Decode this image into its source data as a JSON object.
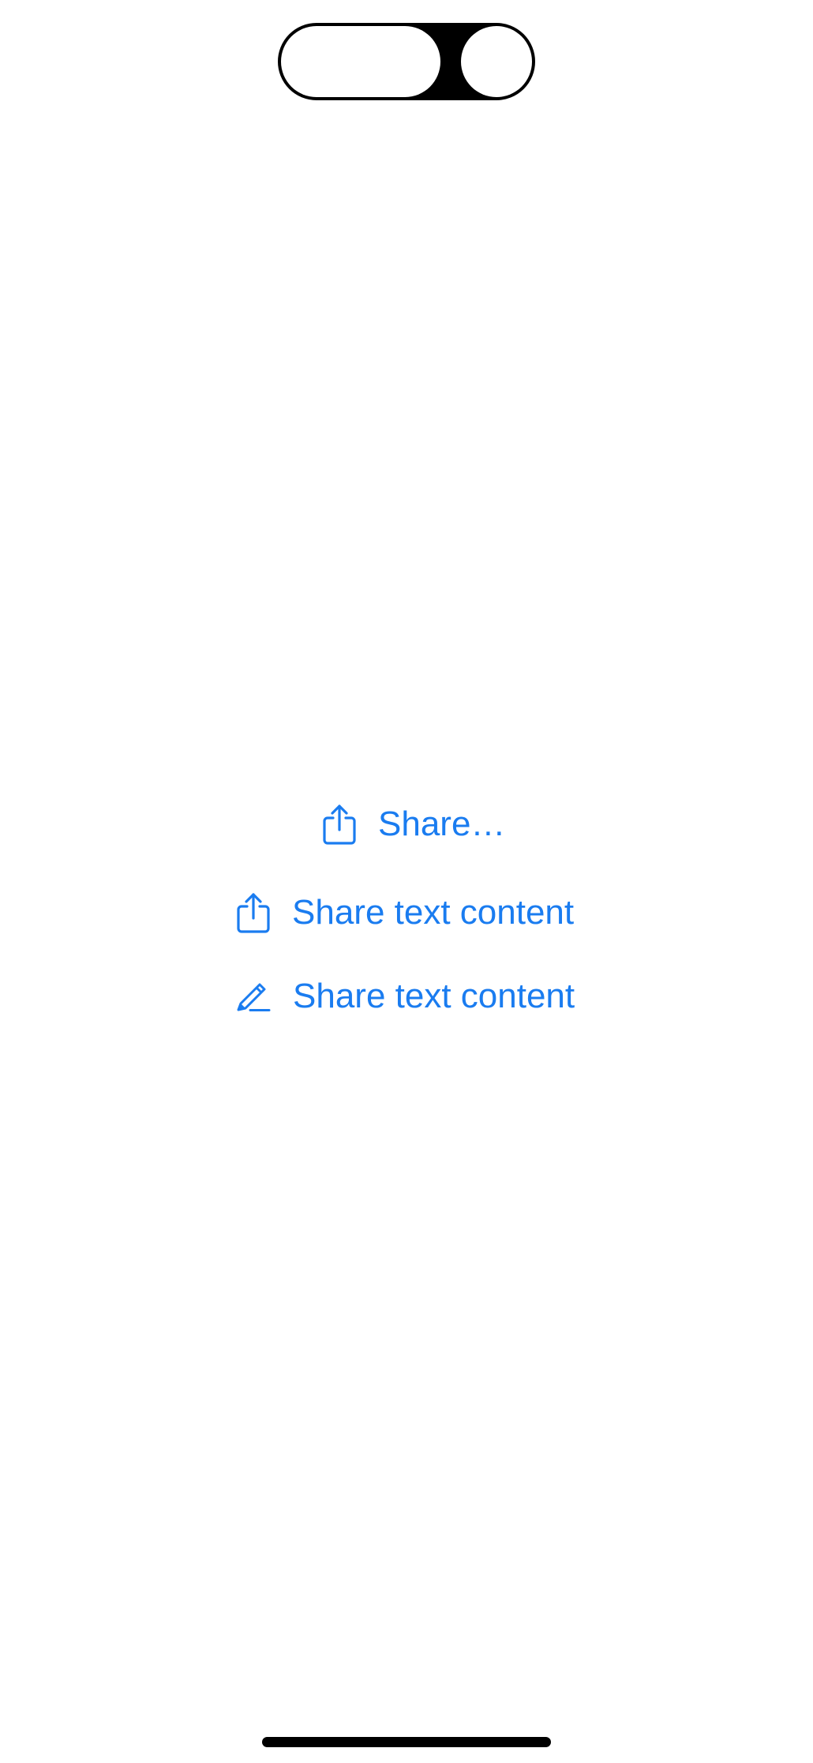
{
  "status_bar": {
    "dynamic_island_icon": "dynamic-island"
  },
  "main": {
    "buttons": [
      {
        "label": "Share…",
        "icon": "share-icon"
      },
      {
        "label": "Share text content",
        "icon": "share-icon"
      },
      {
        "label": "Share text content",
        "icon": "pencil-icon"
      }
    ]
  },
  "colors": {
    "accent": "#1a7cf0",
    "background": "#ffffff"
  }
}
